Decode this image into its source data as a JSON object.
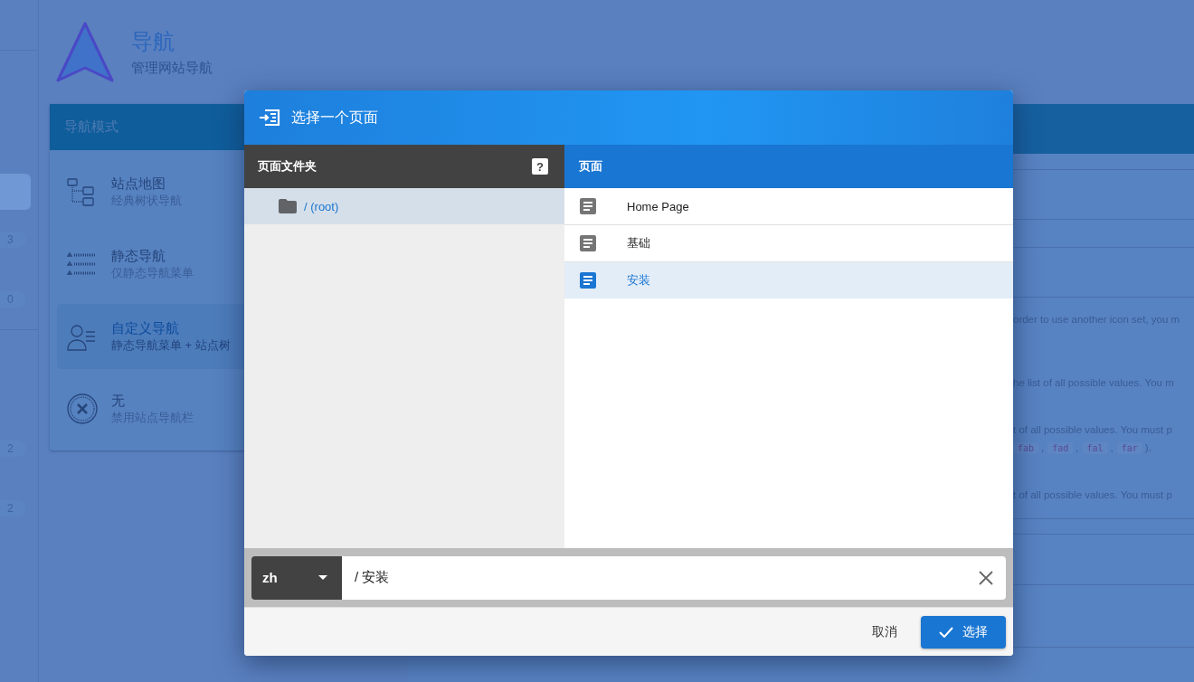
{
  "rail": {
    "items": [
      {
        "kind": "blank"
      },
      {
        "kind": "active"
      },
      {
        "kind": "count",
        "count": "3"
      },
      {
        "kind": "count",
        "count": "0"
      },
      {
        "kind": "blank"
      },
      {
        "kind": "count",
        "count": "2"
      },
      {
        "kind": "count",
        "count": "2"
      }
    ]
  },
  "header": {
    "title": "导航",
    "subtitle": "管理网站导航"
  },
  "nav_mode_card": {
    "title": "导航模式",
    "modes": [
      {
        "kind": "sitemap",
        "title": "站点地图",
        "subtitle": "经典树状导航",
        "selected": false
      },
      {
        "kind": "static",
        "title": "静态导航",
        "subtitle": "仅静态导航菜单",
        "selected": false
      },
      {
        "kind": "custom",
        "title": "自定义导航",
        "subtitle": "静态导航菜单 + 站点树",
        "selected": true
      },
      {
        "kind": "none",
        "title": "无",
        "subtitle": "禁用站点导航栏",
        "selected": false
      }
    ]
  },
  "right_panel": {
    "lines": [
      {
        "kind": "text",
        "text": "order to use another icon set, you m"
      },
      {
        "kind": "text",
        "text": "he list of all possible values. You m"
      },
      {
        "kind": "text",
        "text": "t of all possible values. You must p"
      },
      {
        "kind": "chips",
        "chips": [
          "fab",
          "fad",
          "fal",
          "far"
        ],
        "separator": ",",
        "end": ")."
      },
      {
        "kind": "text",
        "text": "t of all possible values. You must p"
      }
    ]
  },
  "dialog": {
    "title": "选择一个页面",
    "folders": {
      "header": "页面文件夹",
      "help": "?",
      "items": [
        {
          "label": "/ (root)",
          "selected": true
        }
      ]
    },
    "pages": {
      "header": "页面",
      "items": [
        {
          "label": "Home Page",
          "selected": false
        },
        {
          "label": "基础",
          "selected": false
        },
        {
          "label": "安装",
          "selected": true
        }
      ]
    },
    "path": {
      "locale": "zh",
      "value": "/ 安装"
    },
    "buttons": {
      "cancel": "取消",
      "select": "选择"
    }
  }
}
